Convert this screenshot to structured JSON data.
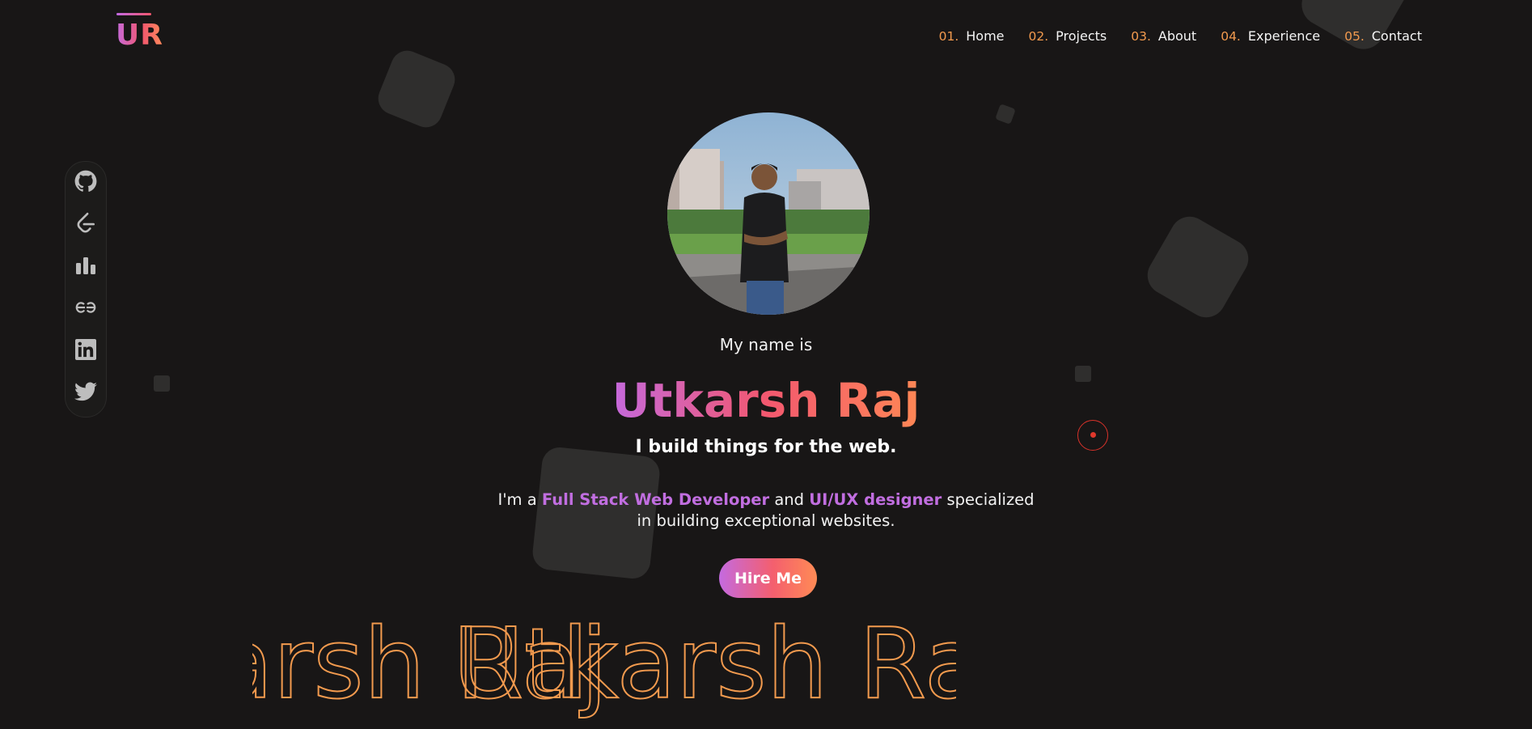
{
  "brand": {
    "logo_text": "UR"
  },
  "nav": {
    "items": [
      {
        "num": "01.",
        "label": "Home"
      },
      {
        "num": "02.",
        "label": "Projects"
      },
      {
        "num": "03.",
        "label": "About"
      },
      {
        "num": "04.",
        "label": "Experience"
      },
      {
        "num": "05.",
        "label": "Contact"
      }
    ]
  },
  "social": {
    "icons": [
      "github-icon",
      "leetcode-icon",
      "stats-icon",
      "geeksforgeeks-icon",
      "linkedin-icon",
      "twitter-icon"
    ]
  },
  "hero": {
    "intro": "My name is",
    "name": "Utkarsh Raj",
    "tagline": "I build things for the web.",
    "desc": {
      "pre": "I'm a ",
      "role1": "Full Stack Web Developer",
      "mid": " and ",
      "role2": "UI/UX designer",
      "post": " specialized",
      "line2": "in building exceptional websites."
    },
    "cta": "Hire Me"
  },
  "marquee": {
    "text": "Utkarsh Raj"
  },
  "colors": {
    "background": "#181616",
    "accent_orange": "#f29a4e",
    "gradient_start": "#c46ae0",
    "gradient_end": "#ff8b55"
  }
}
